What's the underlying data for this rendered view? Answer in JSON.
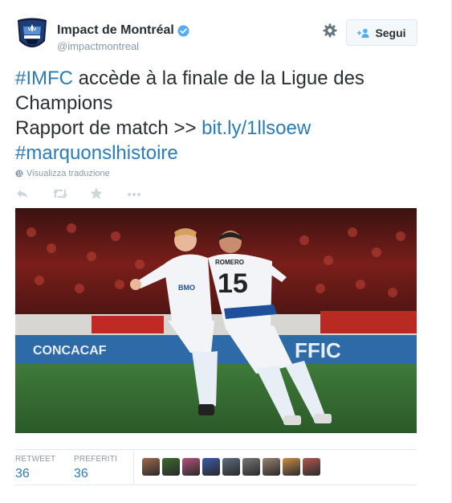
{
  "account": {
    "display_name": "Impact de Montréal",
    "handle": "@impactmontreal",
    "follow_label": "Segui",
    "avatar_icon": "impact-montreal-logo"
  },
  "tweet": {
    "line1_hashtag": "#IMFC",
    "line1_rest": " accède à la finale de la Ligue des Champions",
    "line2_text": "Rapport de match >> ",
    "line2_link": "bit.ly/1llsoew",
    "line3_hashtag": "#marquonslhistoire",
    "translate_label": "Visualizza traduzione"
  },
  "media": {
    "description_icon": "soccer-celebration-photo",
    "jersey_name": "ROMERO",
    "jersey_number": "15",
    "sponsor": "BMO",
    "board_left": "CONCACAF",
    "board_right": "FFIC"
  },
  "stats": {
    "retweet_label": "RETWEET",
    "retweet_count": "36",
    "favorites_label": "PREFERITI",
    "favorites_count": "36"
  },
  "colors": {
    "link": "#2b7bb9",
    "muted": "#8899a6",
    "text": "#292f33",
    "verified": "#55acee"
  },
  "faces": [
    "#a06a4a",
    "#3d6b2e",
    "#b5527a",
    "#3a5aa8",
    "#5d6d80",
    "#777777",
    "#9a8070",
    "#c88c4a",
    "#b05a50"
  ]
}
